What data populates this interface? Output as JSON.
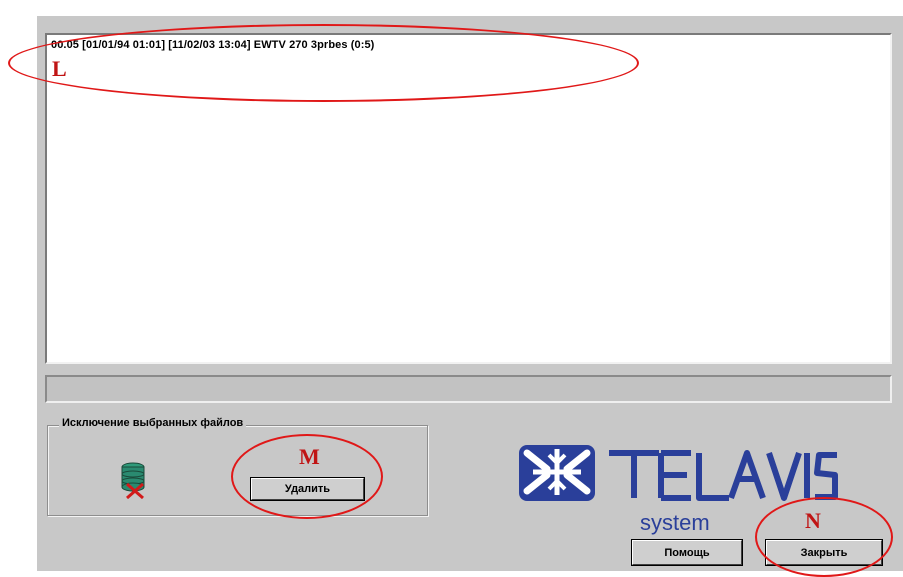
{
  "file_list": {
    "items": [
      "00.05  [01/01/94 01:01] [11/02/03 13:04] EWTV 270 3prbes (0:5)"
    ]
  },
  "status_bar": {
    "text": ""
  },
  "exclusion_group": {
    "title": "Исключение выбранных файлов",
    "delete_button": "Удалить",
    "icon": "database-delete-icon"
  },
  "logo": {
    "brand": "TELEVIS",
    "tagline": "system",
    "color": "#2a3f9a"
  },
  "footer": {
    "help_button": "Помощь",
    "close_button": "Закрыть"
  },
  "annotations": [
    {
      "letter": "L",
      "color": "#e01818"
    },
    {
      "letter": "M",
      "color": "#e01818"
    },
    {
      "letter": "N",
      "color": "#e01818"
    }
  ]
}
